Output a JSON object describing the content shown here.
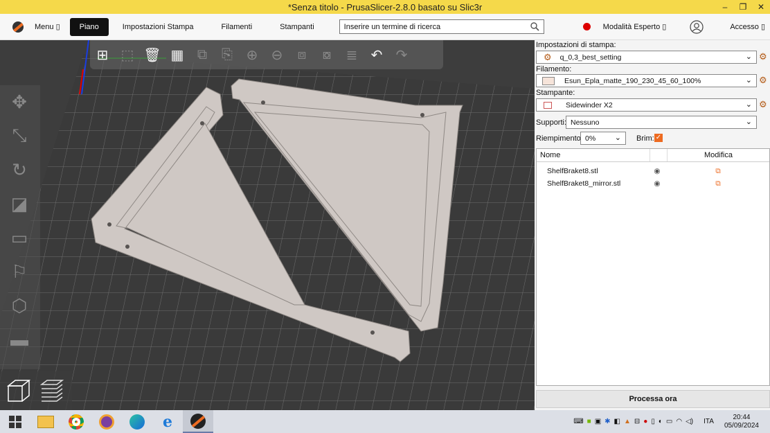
{
  "window": {
    "title": "*Senza titolo - PrusaSlicer-2.8.0 basato su Slic3r",
    "minimize": "–",
    "maximize": "❐",
    "close": "✕"
  },
  "topbar": {
    "menu": "Menu",
    "tabs": [
      "Piano",
      "Impostazioni Stampa",
      "Filamenti",
      "Stampanti"
    ],
    "search_placeholder": "Inserire un termine di ricerca",
    "mode": "Modalità Esperto",
    "access": "Accesso",
    "dropdown_glyph": "▯"
  },
  "settings": {
    "print_label": "Impostazioni di stampa:",
    "print_value": "q_0,3_best_setting",
    "filament_label": "Filamento:",
    "filament_value": "Esun_Epla_matte_190_230_45_60_100%",
    "filament_color": "#f6e4da",
    "printer_label": "Stampante:",
    "printer_value": "Sidewinder X2",
    "supports_label": "Supporti:",
    "supports_value": "Nessuno",
    "infill_label": "Riempimento:",
    "infill_value": "0%",
    "brim_label": "Brim:",
    "brim_checked": true
  },
  "object_list": {
    "col_name": "Nome",
    "col_edit": "Modifica",
    "rows": [
      {
        "name": "ShelfBraket8.stl"
      },
      {
        "name": "ShelfBraket8_mirror.stl"
      }
    ]
  },
  "process_button": "Processa ora",
  "taskbar": {
    "language": "ITA",
    "time": "20:44",
    "date": "05/09/2024"
  },
  "colors": {
    "accent": "#ed6b21",
    "title_bar": "#f5d94a",
    "bed": "#3d3d3d",
    "model": "#c8c1bd"
  }
}
